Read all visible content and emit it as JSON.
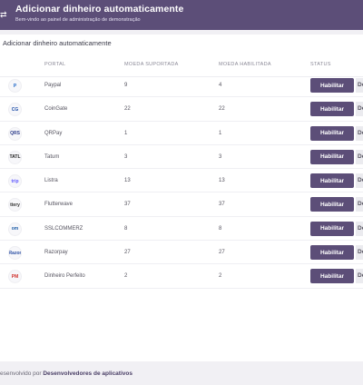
{
  "header": {
    "menu_icon": "swap-icon",
    "title": "Adicionar dinheiro automaticamente",
    "subtitle": "Bem-vindo ao painel de administração de demonstração"
  },
  "card": {
    "title": "Adicionar dinheiro automaticamente",
    "columns": {
      "portal": "PORTAL",
      "supported": "MOEDA SUPORTADA",
      "enabled": "MOEDA HABILITADA",
      "status": "STATUS"
    },
    "rows": [
      {
        "logo": "paypal-icon",
        "logo_text": "P",
        "logo_color": "#1f67c7",
        "name": "Paypal",
        "supported": "9",
        "enabled": "4",
        "button": "Habilitar",
        "button2": "De"
      },
      {
        "logo": "coingate-icon",
        "logo_text": "CG",
        "logo_color": "#1e4fa8",
        "name": "CoinGate",
        "supported": "22",
        "enabled": "22",
        "button": "Habilitar",
        "button2": "De"
      },
      {
        "logo": "qrpay-icon",
        "logo_text": "QRS",
        "logo_color": "#2f3e8c",
        "name": "QRPay",
        "supported": "1",
        "enabled": "1",
        "button": "Habilitar",
        "button2": "De"
      },
      {
        "logo": "tatum-icon",
        "logo_text": "TATL",
        "logo_color": "#222222",
        "name": "Tatum",
        "supported": "3",
        "enabled": "3",
        "button": "Habilitar",
        "button2": "De"
      },
      {
        "logo": "listra-icon",
        "logo_text": "trip",
        "logo_color": "#635bff",
        "name": "Listra",
        "supported": "13",
        "enabled": "13",
        "button": "Habilitar",
        "button2": "De"
      },
      {
        "logo": "flutterwave-icon",
        "logo_text": "ttery",
        "logo_color": "#333333",
        "name": "Flutterwave",
        "supported": "37",
        "enabled": "37",
        "button": "Habilitar",
        "button2": "De"
      },
      {
        "logo": "sslcommerz-icon",
        "logo_text": "om",
        "logo_color": "#1f5ea8",
        "name": "SSLCOMMERZ",
        "supported": "8",
        "enabled": "8",
        "button": "Habilitar",
        "button2": "De"
      },
      {
        "logo": "razorpay-icon",
        "logo_text": "Razor",
        "logo_color": "#2a4ea3",
        "name": "Razorpay",
        "supported": "27",
        "enabled": "27",
        "button": "Habilitar",
        "button2": "De"
      },
      {
        "logo": "perfect-money-icon",
        "logo_text": "PM",
        "logo_color": "#d0312d",
        "name": "Dinheiro Perfeito",
        "supported": "2",
        "enabled": "2",
        "button": "Habilitar",
        "button2": "De"
      }
    ]
  },
  "footer": {
    "prefix": "esenvolvido por ",
    "brand": "Desenvolvedores de aplicativos"
  }
}
